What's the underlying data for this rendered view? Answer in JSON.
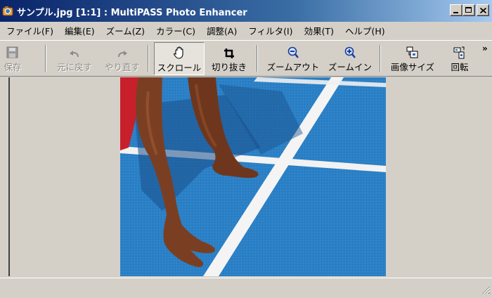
{
  "window": {
    "title": "サンプル.jpg [1:1] : MultiPASS Photo Enhancer",
    "controls": [
      "minimize",
      "maximize",
      "close"
    ]
  },
  "menubar": {
    "items": [
      {
        "label": "ファイル(F)"
      },
      {
        "label": "編集(E)"
      },
      {
        "label": "ズーム(Z)"
      },
      {
        "label": "カラー(C)"
      },
      {
        "label": "調整(A)"
      },
      {
        "label": "フィルタ(I)"
      },
      {
        "label": "効果(T)"
      },
      {
        "label": "ヘルプ(H)"
      }
    ]
  },
  "toolbar": {
    "save": {
      "label": "保存",
      "icon": "floppy-disk-icon",
      "enabled": false
    },
    "undo": {
      "label": "元に戻す",
      "icon": "undo-icon",
      "enabled": false
    },
    "redo": {
      "label": "やり直す",
      "icon": "redo-icon",
      "enabled": false
    },
    "scroll": {
      "label": "スクロール",
      "icon": "hand-icon",
      "active": true
    },
    "crop": {
      "label": "切り抜き",
      "icon": "crop-icon"
    },
    "zoom_out": {
      "label": "ズームアウト",
      "icon": "zoom-out-icon"
    },
    "zoom_in": {
      "label": "ズームイン",
      "icon": "zoom-in-icon"
    },
    "image_size": {
      "label": "画像サイズ",
      "icon": "image-size-icon"
    },
    "rotate": {
      "label": "回転",
      "icon": "rotate-icon"
    },
    "overflow": {
      "label": "»"
    }
  },
  "colors": {
    "track_blue": "#2a7fc4",
    "lane_white": "#f4f4f4",
    "skin": "#7a3f22",
    "shorts": "#c8202a"
  }
}
